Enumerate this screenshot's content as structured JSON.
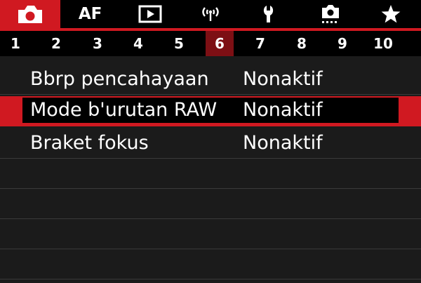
{
  "tabs": [
    {
      "icon": "camera-icon",
      "active": true
    },
    {
      "label": "AF",
      "active": false
    },
    {
      "icon": "playback-icon",
      "active": false
    },
    {
      "icon": "wireless-icon",
      "active": false
    },
    {
      "icon": "wrench-icon",
      "active": false
    },
    {
      "icon": "custom-function-icon",
      "active": false
    },
    {
      "icon": "star-icon",
      "active": false
    }
  ],
  "pages": [
    "1",
    "2",
    "3",
    "4",
    "5",
    "6",
    "7",
    "8",
    "9",
    "10"
  ],
  "active_page": "6",
  "menu_items": [
    {
      "label": "Bbrp pencahayaan",
      "value": "Nonaktif"
    },
    {
      "label": "Mode b'urutan RAW",
      "value": "Nonaktif",
      "selected": true
    },
    {
      "label": "Braket fokus",
      "value": "Nonaktif"
    }
  ],
  "colors": {
    "accent_red": "#d01921",
    "active_page_bg": "#7d0f14",
    "background": "#1b1b1b"
  }
}
